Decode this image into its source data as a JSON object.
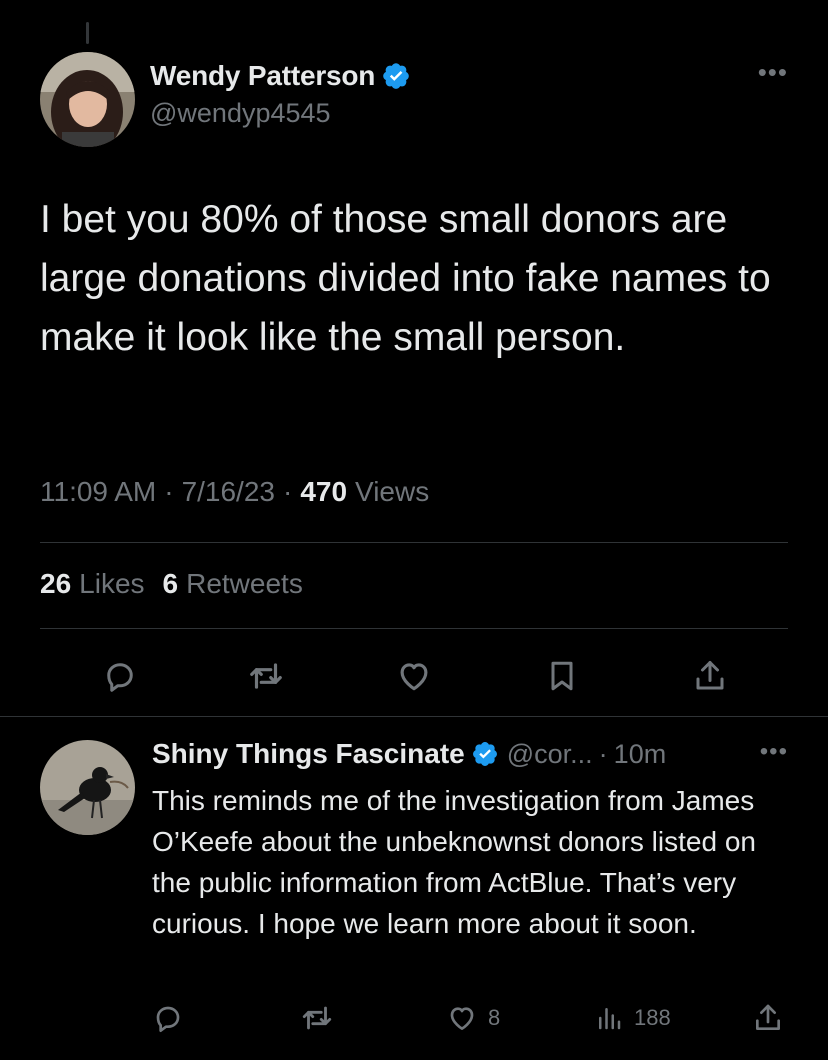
{
  "tweet": {
    "display_name": "Wendy Patterson",
    "handle": "@wendyp4545",
    "more_icon": "more-dots-icon",
    "text": "I bet you 80% of those small donors are large donations divided into fake names to make it look like the small person.",
    "time": "11:09 AM",
    "date": "7/16/23",
    "views_count": "470",
    "views_label": "Views",
    "likes_count": "26",
    "likes_label": "Likes",
    "retweets_count": "6",
    "retweets_label": "Retweets",
    "separator": "·",
    "actions": [
      "reply-icon",
      "retweet-icon",
      "like-icon",
      "bookmark-icon",
      "share-icon"
    ]
  },
  "reply": {
    "display_name": "Shiny Things Fascinate",
    "handle": "@cor...",
    "separator": "·",
    "time": "10m",
    "text": "This reminds me of the investigation from James O’Keefe about the unbeknownst donors listed on the public information from ActBlue. That’s very curious. I hope we learn more about it soon.",
    "likes": "8",
    "views": "188"
  },
  "colors": {
    "background": "#000000",
    "text_primary": "#e7e9ea",
    "text_secondary": "#71767b",
    "verified_blue": "#1d9bf0",
    "divider": "#2f3336"
  }
}
